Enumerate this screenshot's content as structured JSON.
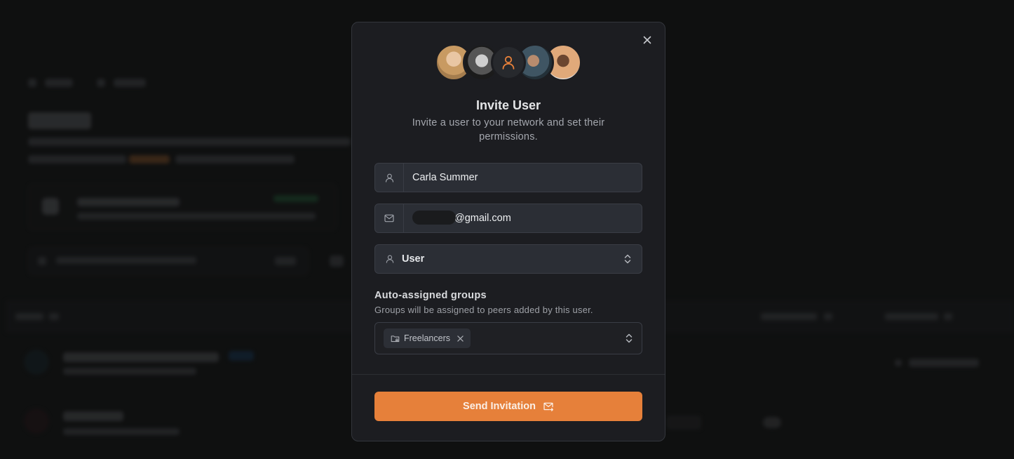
{
  "modal": {
    "title": "Invite User",
    "subtitle": "Invite a user to your network and set their permissions.",
    "close_icon": "close-icon",
    "avatars": [
      {
        "name": "avatar-woman-blonde",
        "kind": "photo"
      },
      {
        "name": "avatar-man-curly-hair",
        "kind": "photo"
      },
      {
        "name": "avatar-user-placeholder",
        "kind": "icon",
        "icon": "user-icon",
        "color": "#e6803a"
      },
      {
        "name": "avatar-man-profile",
        "kind": "photo"
      },
      {
        "name": "avatar-man-cap",
        "kind": "photo"
      }
    ],
    "name_field": {
      "icon": "user-icon",
      "value": "Carla Summer"
    },
    "email_field": {
      "icon": "mail-icon",
      "value_visible": "@gmail.com",
      "redacted": true
    },
    "role_select": {
      "icon": "user-icon",
      "selected": "User",
      "chevron_icon": "chevron-up-down-icon"
    },
    "groups": {
      "label": "Auto-assigned groups",
      "help": "Groups will be assigned to peers added by this user.",
      "chips": [
        {
          "label": "Freelancers",
          "icon": "folder-group-icon",
          "remove_icon": "close-icon"
        }
      ],
      "chevron_icon": "chevron-up-down-icon"
    },
    "submit": {
      "label": "Send Invitation",
      "icon": "mail-send-icon"
    }
  },
  "colors": {
    "accent": "#e6803a",
    "modal_bg": "#1c1d21",
    "input_bg": "#2b2e35",
    "page_bg": "#121313"
  }
}
